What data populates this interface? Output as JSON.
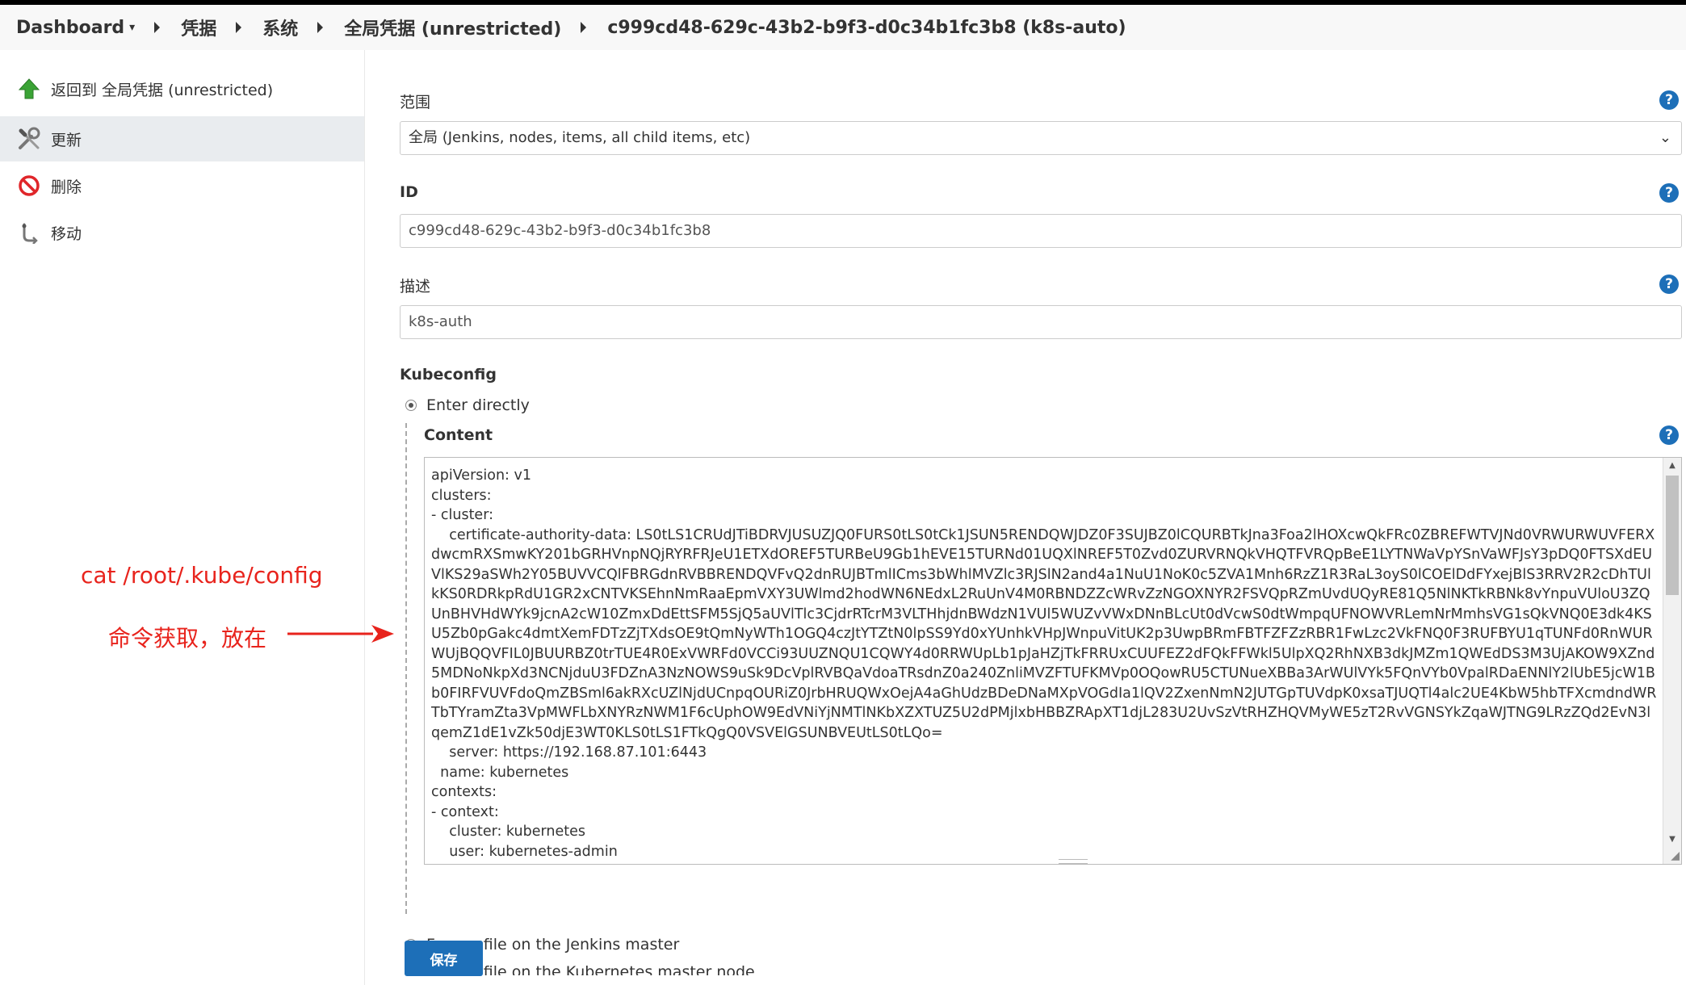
{
  "breadcrumb": {
    "items": [
      "Dashboard",
      "凭据",
      "系统",
      "全局凭据 (unrestricted)",
      "c999cd48-629c-43b2-b9f3-d0c34b1fc3b8 (k8s-auto)"
    ],
    "dropdown_caret": "▾"
  },
  "sidebar": {
    "items": [
      {
        "label": "返回到 全局凭据 (unrestricted)",
        "icon": "green-up-arrow-icon",
        "active": false
      },
      {
        "label": "更新",
        "icon": "wrench-screwdriver-icon",
        "active": true
      },
      {
        "label": "删除",
        "icon": "no-entry-icon",
        "active": false
      },
      {
        "label": "移动",
        "icon": "move-icon",
        "active": false
      }
    ]
  },
  "form": {
    "scope_label": "范围",
    "scope_value": "全局 (Jenkins, nodes, items, all child items, etc)",
    "id_label": "ID",
    "id_value": "c999cd48-629c-43b2-b9f3-d0c34b1fc3b8",
    "description_label": "描述",
    "description_value": "k8s-auth",
    "kubeconfig_label": "Kubeconfig",
    "option_enter_directly": "Enter directly",
    "content_label": "Content",
    "content_value": "apiVersion: v1\nclusters:\n- cluster:\n    certificate-authority-data: LS0tLS1CRUdJTiBDRVJUSUZJQ0FURS0tLS0tCk1JSUN5RENDQWJDZ0F3SUJBZ0lCQURBTkJna3Foa2lHOXcwQkFRc0ZBREFWTVJNd0VRWURWUVFERXdwcmRXSmwKY201bGRHVnpNQjRYRFRJeU1ETXdOREF5TURBeU9Gb1hEVE15TURNd01UQXlNREF5T0Zvd0ZURVRNQkVHQTFVRQpBeE1LYTNWaVpYSnVaWFJsY3pDQ0FTSXdEUVlKS29aSWh2Y05BUVVCQlFBRGdnRVBBRENDQVFvQ2dnRUJBTmlICms3bWhlMVZlc3RJSlN2and4a1NuU1NoK0c5ZVA1Mnh6RzZ1R3RaL3oyS0lCOElDdFYxejBlS3RRV2R2cDhTUlkKS0RDRkpRdU1GR2xCNTVKSEhnNmRaaEpmVXY3UWlmd2hodWN6NEdxL2RuUnV4M0RBNDZZcWRvZzNGOXNYR2FSVQpRZmUvdUQyRE81Q5NlNKTkRBNk8vYnpuVUloU3ZQUnBHVHdWYk9jcnA2cW10ZmxDdEttSFM5SjQ5aUVlTlc3CjdrRTcrM3VLTHhjdnBWdzN1VUl5WUZvVWxDNnBLcUt0dVcwS0dtWmpqUFNOWVRLemNrMmhsVG1sQkVNQ0E3dk4KSU5Zb0pGakc4dmtXemFDTzZjTXdsOE9tQmNyWTh1OGQ4czJtYTZtN0lpSS9Yd0xYUnhkVHpJWnpuVitUK2p3UwpBRmFBTFZFZzRBR1FwLzc2VkFNQ0F3RUFBYU1qTUNFd0RnWURWUjBQQVFIL0JBUURBZ0trTUE4R0ExVWRFd0VCCi93UUZNQU1CQWY4d0RRWUpLb1pJaHZjTkFRRUxCUUFEZ2dFQkFFWkl5UlpXQ2RhNXB3dkJMZm1QWEdDS3M3UjAKOW9XZnd5MDNoNkpXd3NCNjduU3FDZnA3NzNOWS9uSk9DcVplRVBQaVdoaTRsdnZ0a240ZnliMVZFTUFKMVp0OQowRU5CTUNueXBBa3ArWUlVYk5FQnVYb0VpalRDaENNlY2lUbE5jcW1Bb0FIRFVUVFdoQmZBSml6akRXcUZlNjdUCnpqOURiZ0JrbHRUQWxOejA4aGhUdzBDeDNaMXpVOGdIa1lQV2ZxenNmN2JUTGpTUVdpK0xsaTJUQTl4alc2UE4KbW5hbTFXcmdndWRTbTYramZta3VpMWFLbXNYRzNWM1F6cUphOW9EdVNiYjNMTlNKbXZXTUZ5U2dPMjlxbHBBZRApXT1djL283U2UvSzVtRHZHQVMyWE5zT2RvVGNSYkZqaWJTNG9LRzZQd2EvN3lqemZ1dE1vZk50djE3WT0KLS0tLS1FTkQgQ0VSVElGSUNBVEUtLS0tLQo=\n    server: https://192.168.87.101:6443\n  name: kubernetes\ncontexts:\n- context:\n    cluster: kubernetes\n    user: kubernetes-admin",
    "option_file_jenkins": "From a file on the Jenkins master",
    "option_file_k8s": "From a file on the Kubernetes master node",
    "save_label": "保存",
    "help_glyph": "?"
  },
  "annotation": {
    "command": "cat  /root/.kube/config",
    "note": "命令获取，放在",
    "color": "#e8231c"
  },
  "colors": {
    "accent": "#1d6fb8",
    "active_item_bg": "#e9ecef"
  }
}
